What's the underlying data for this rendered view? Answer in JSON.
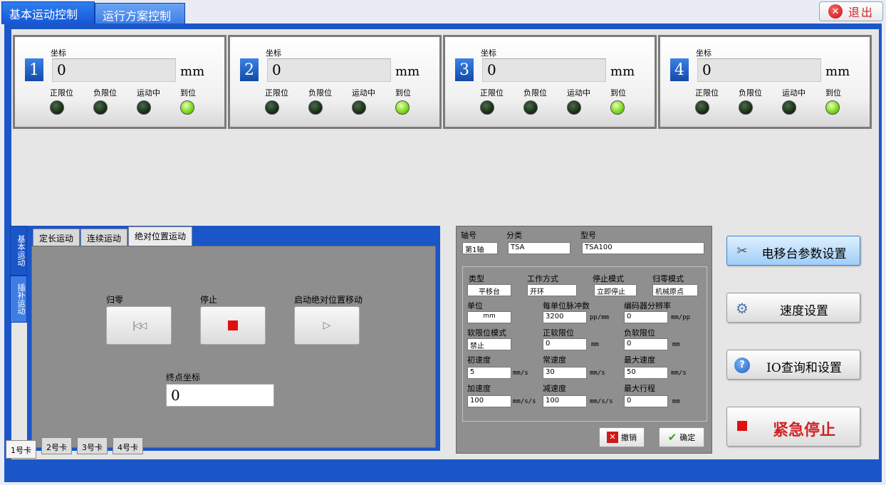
{
  "top_tabs": [
    "基本运动控制",
    "运行方案控制"
  ],
  "exit_label": "退出",
  "axes": [
    {
      "num": "1",
      "coord_label": "坐标",
      "coord": "0",
      "unit": "mm",
      "indicators": [
        {
          "label": "正限位",
          "on": false
        },
        {
          "label": "负限位",
          "on": false
        },
        {
          "label": "运动中",
          "on": false
        },
        {
          "label": "到位",
          "on": true
        }
      ]
    },
    {
      "num": "2",
      "coord_label": "坐标",
      "coord": "0",
      "unit": "mm",
      "indicators": [
        {
          "label": "正限位",
          "on": false
        },
        {
          "label": "负限位",
          "on": false
        },
        {
          "label": "运动中",
          "on": false
        },
        {
          "label": "到位",
          "on": true
        }
      ]
    },
    {
      "num": "3",
      "coord_label": "坐标",
      "coord": "0",
      "unit": "mm",
      "indicators": [
        {
          "label": "正限位",
          "on": false
        },
        {
          "label": "负限位",
          "on": false
        },
        {
          "label": "运动中",
          "on": false
        },
        {
          "label": "到位",
          "on": true
        }
      ]
    },
    {
      "num": "4",
      "coord_label": "坐标",
      "coord": "0",
      "unit": "mm",
      "indicators": [
        {
          "label": "正限位",
          "on": false
        },
        {
          "label": "负限位",
          "on": false
        },
        {
          "label": "运动中",
          "on": false
        },
        {
          "label": "到位",
          "on": true
        }
      ]
    }
  ],
  "side_tabs": [
    "基本运动",
    "插补运动"
  ],
  "motion_tabs": [
    "定长运动",
    "连续运动",
    "绝对位置运动"
  ],
  "motion": {
    "home_label": "归零",
    "stop_label": "停止",
    "start_label": "启动绝对位置移动",
    "end_coord_label": "终点坐标",
    "end_coord_value": "0"
  },
  "params": {
    "axis_label": "轴号",
    "axis_value": "第1轴",
    "category_label": "分类",
    "category_value": "TSA",
    "model_label": "型号",
    "model_value": "TSA100",
    "type_label": "类型",
    "type_value": "平移台",
    "workmode_label": "工作方式",
    "workmode_value": "开环",
    "stopmode_label": "停止模式",
    "stopmode_value": "立即停止",
    "homemode_label": "归零模式",
    "homemode_value": "机械原点",
    "unit_label": "单位",
    "unit_value": "mm",
    "pulses_label": "每单位脉冲数",
    "pulses_value": "3200",
    "pulses_unit": "pp/mm",
    "encoder_label": "编码器分辨率",
    "encoder_value": "0",
    "encoder_unit": "mm/pp",
    "softlimit_mode_label": "软限位模式",
    "softlimit_mode_value": "禁止",
    "pos_softlimit_label": "正软限位",
    "pos_softlimit_value": "0",
    "pos_softlimit_unit": "mm",
    "neg_softlimit_label": "负软限位",
    "neg_softlimit_value": "0",
    "neg_softlimit_unit": "mm",
    "init_speed_label": "初速度",
    "init_speed_value": "5",
    "init_speed_unit": "mm/s",
    "normal_speed_label": "常速度",
    "normal_speed_value": "30",
    "normal_speed_unit": "mm/s",
    "max_speed_label": "最大速度",
    "max_speed_value": "50",
    "max_speed_unit": "mm/s",
    "accel_label": "加速度",
    "accel_value": "100",
    "accel_unit": "mm/s/s",
    "decel_label": "减速度",
    "decel_value": "100",
    "decel_unit": "mm/s/s",
    "max_travel_label": "最大行程",
    "max_travel_value": "0",
    "max_travel_unit": "mm",
    "cancel_label": "撤销",
    "confirm_label": "确定"
  },
  "actions": {
    "stage_params": "电移台参数设置",
    "speed": "速度设置",
    "io": "IO查询和设置",
    "estop": "紧急停止"
  },
  "card_tabs": [
    "1号卡",
    "2号卡",
    "3号卡",
    "4号卡"
  ],
  "colors": {
    "frame_blue": "#1b56c9",
    "led_on": "#7fdc1a",
    "estop_red": "#d12424"
  }
}
